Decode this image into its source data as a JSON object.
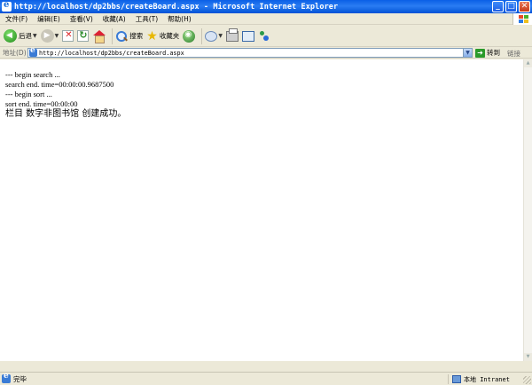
{
  "window": {
    "title": "http://localhost/dp2bbs/createBoard.aspx - Microsoft Internet Explorer",
    "buttons": {
      "minimize": "_",
      "maximize": "□",
      "close": "✕"
    }
  },
  "menu": {
    "items": [
      {
        "label": "文件(F)"
      },
      {
        "label": "编辑(E)"
      },
      {
        "label": "查看(V)"
      },
      {
        "label": "收藏(A)"
      },
      {
        "label": "工具(T)"
      },
      {
        "label": "帮助(H)"
      }
    ]
  },
  "toolbar": {
    "back_label": "后退",
    "search_label": "搜索",
    "favorites_label": "收藏夹",
    "icons": [
      "back-icon",
      "forward-icon",
      "stop-icon",
      "refresh-icon",
      "home-icon",
      "search-icon",
      "favorites-icon",
      "media-icon",
      "mail-icon",
      "print-icon",
      "edit-icon",
      "messenger-icon"
    ]
  },
  "address": {
    "label": "地址(D)",
    "url": "http://localhost/dp2bbs/createBoard.aspx",
    "go_label": "转到",
    "links_label": "链接"
  },
  "content": {
    "lines": [
      "--- begin search ...",
      "search end. time=00:00:00.9687500",
      "--- begin sort ...",
      "sort end. time=00:00:00",
      "栏目 数字非图书馆 创建成功。"
    ]
  },
  "status": {
    "text": "完毕",
    "zone": "本地 Intranet"
  }
}
